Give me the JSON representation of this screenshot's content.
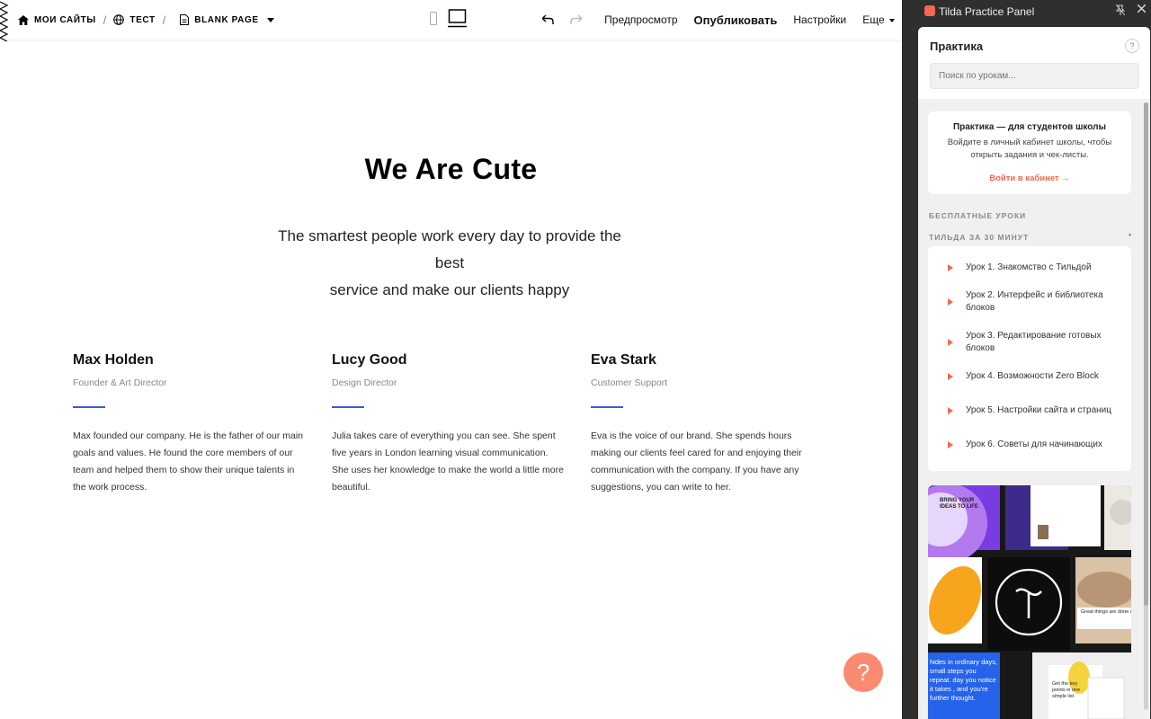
{
  "topbar": {
    "my_sites": "МОИ САЙТЫ",
    "site_name": "ТЕСТ",
    "page_name": "BLANK PAGE",
    "preview": "Предпросмотр",
    "publish": "Опубликовать",
    "settings": "Настройки",
    "more": "Еще",
    "icons": [
      "home-icon",
      "globe-icon",
      "page-icon",
      "mobile-icon",
      "desktop-icon",
      "undo-icon",
      "redo-icon"
    ]
  },
  "page": {
    "title": "We Are Cute",
    "subtitle_line1": "The smartest people work every day to provide the best",
    "subtitle_line2": "service and make our clients happy",
    "team": [
      {
        "name": "Max Holden",
        "role": "Founder & Art Director",
        "bio": "Max founded our company. He is the father of our main goals and values. He found the core members of our team and helped them to show their unique talents in the work process."
      },
      {
        "name": "Lucy Good",
        "role": "Design Director",
        "bio": "Julia takes care of everything you can see. She spent five years in London learning visual communication. She uses her knowledge to make the world a little more beautiful."
      },
      {
        "name": "Eva Stark",
        "role": "Customer Support",
        "bio": "Eva is the voice of our brand. She spends hours making our clients feel cared for and enjoying their communication with the company. If you have any suggestions, you can write to her."
      }
    ],
    "help_button": "?",
    "accent_color": "#3a5bd9",
    "help_color": "#fa8b70"
  },
  "panel": {
    "title": "Tilda Practice Panel",
    "heading": "Практика",
    "help": "?",
    "search_placeholder": "Поиск по урокам...",
    "login_title": "Практика — для студентов школы",
    "login_text": "Войдите в личный кабинет школы, чтобы открыть задания и чек-листы.",
    "login_link": "Войти в кабинет →",
    "free_lessons_label": "БЕСПЛАТНЫЕ УРОКИ",
    "course_label": "ТИЛЬДА ЗА 30 МИНУТ",
    "course_marker": "•",
    "lessons": [
      "Урок 1. Знакомство с Тильдой",
      "Урок 2. Интерфейс и библиотека блоков",
      "Урок 3. Редактирование готовых блоков",
      "Урок 4. Возможности Zero Block",
      "Урок 5. Настройки сайта и страниц",
      "Урок 6. Советы для начинающих"
    ],
    "thumbnail": {
      "text_1": "BRING YOUR IDEAS TO LIFE",
      "text_2": "Great things are done of small things brough",
      "text_3": "hides in ordinary days, small steps you repeat. day you notice it takes , and you're further thought.",
      "text_4": "Get the key points in one simple list"
    },
    "accent_color": "#f4684f"
  }
}
